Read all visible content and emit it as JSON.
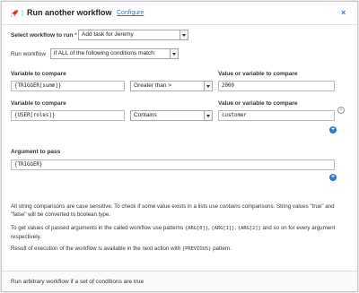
{
  "header": {
    "title": "Run another workflow",
    "configure": "Configure",
    "close": "×"
  },
  "workflow": {
    "label": "Select workflow to run",
    "required": "*",
    "value": "Add task for Jeremy"
  },
  "run_mode": {
    "label": "Run workflow",
    "value": "if ALL of the following conditions match:"
  },
  "conditions": [
    {
      "var_label": "Variable to compare",
      "var_value": "{TRIGGER[summ]}",
      "operator": "Greater than >",
      "cmp_label": "Value or variable to compare",
      "cmp_value": "2000"
    },
    {
      "var_label": "Variable to compare",
      "var_value": "{USER[roles]}",
      "operator": "Contains",
      "cmp_label": "Value or variable to compare",
      "cmp_value": "customer"
    }
  ],
  "argument": {
    "label": "Argument to pass",
    "value": "{TRIGGER}"
  },
  "notes": {
    "p1_a": "All string comparisons are case sensitive. To check if some value exists in a lists use ",
    "p1_em": "contains",
    "p1_b": " comparisons. String values \"true\" and \"false\" will be converted to boolean type.",
    "p2_a": "To get values of passed arguments in the called workflow use patterns ",
    "p2_c1": "{ARG[0]}",
    "p2_sep1": ", ",
    "p2_c2": "{ARG[1]}",
    "p2_sep2": ", ",
    "p2_c3": "{ARG[2]}",
    "p2_b": " and so on for every argument respectively.",
    "p3_a": "Result of execution of the workflow is available in the next action with ",
    "p3_c": "{PREVIOUS}",
    "p3_b": " pattern."
  },
  "footer": {
    "text": "Run arbitrary workflow if a set of conditions are true"
  },
  "colors": {
    "accent": "#2a76c6",
    "rocket": "#d9302c",
    "required": "#d9302c"
  },
  "icons": {
    "rocket": "rocket-icon",
    "close": "close-icon",
    "add": "plus-circle-icon",
    "remove": "x-circle-icon"
  }
}
